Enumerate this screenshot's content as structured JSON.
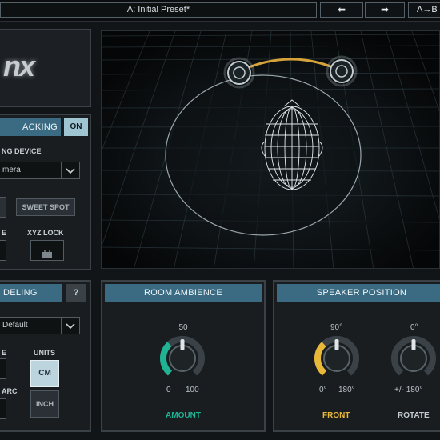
{
  "topbar": {
    "preset_name": "A: Initial Preset*",
    "prev_label": "⬅",
    "next_label": "➡",
    "ab_label": "A→B"
  },
  "logo": {
    "text": "nx"
  },
  "head_tracking": {
    "title": "ACKING",
    "toggle": "ON",
    "device_label": "NG DEVICE",
    "device_value": "mera",
    "sweet_spot_label": "SWEET SPOT",
    "left_partial_label": "E",
    "xyz_lock_label": "XYZ LOCK"
  },
  "modeling": {
    "title": "DELING",
    "help": "?",
    "preset_value": "Default",
    "partial_label_1": "E",
    "partial_label_2": "ARC",
    "units_label": "UNITS",
    "unit_cm": "CM",
    "unit_inch": "INCH"
  },
  "room_ambience": {
    "title": "ROOM AMBIENCE",
    "value_top": "50",
    "min": "0",
    "max": "100",
    "control_label": "AMOUNT",
    "amount": 0.35
  },
  "speaker_position": {
    "title": "SPEAKER POSITION",
    "front_top": "90°",
    "front_min": "0°",
    "front_max": "180°",
    "front_label": "FRONT",
    "front_amount": 0.35,
    "rotate_top": "0°",
    "rotate_range": "+/- 180°",
    "rotate_label": "ROTATE"
  },
  "colors": {
    "accent_teal": "#1fb394",
    "accent_yellow": "#e8b939",
    "header_blue": "#3b6b82",
    "toggle_on": "#9fc5d2"
  }
}
